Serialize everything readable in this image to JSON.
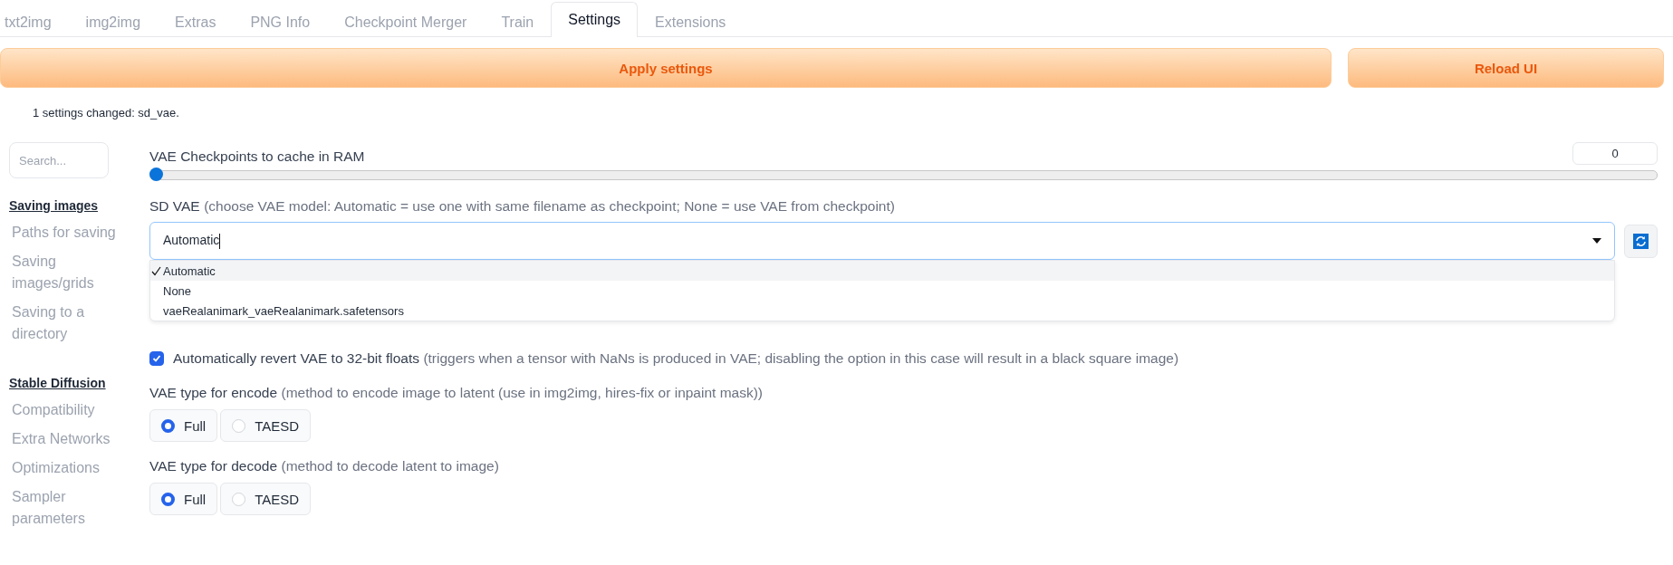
{
  "tabs": [
    {
      "label": "txt2img",
      "selected": false
    },
    {
      "label": "img2img",
      "selected": false
    },
    {
      "label": "Extras",
      "selected": false
    },
    {
      "label": "PNG Info",
      "selected": false
    },
    {
      "label": "Checkpoint Merger",
      "selected": false
    },
    {
      "label": "Train",
      "selected": false
    },
    {
      "label": "Settings",
      "selected": true
    },
    {
      "label": "Extensions",
      "selected": false
    }
  ],
  "buttons": [
    {
      "label": "Apply settings"
    },
    {
      "label": "Reload UI"
    }
  ],
  "status": "1 settings changed: sd_vae.",
  "sidebar": {
    "search": {
      "placeholder": "Search..."
    },
    "sections": [
      {
        "title": "Saving images",
        "items": [
          "Paths for saving",
          "Saving images/grids",
          "Saving to a directory"
        ]
      },
      {
        "title": "Stable Diffusion",
        "items": [
          "Compatibility",
          "Extra Networks",
          "Optimizations",
          "Sampler parameters"
        ]
      }
    ]
  },
  "settings": [
    {
      "kind": "slider",
      "label": "VAE Checkpoints to cache in RAM",
      "value": "0",
      "level": 0
    },
    {
      "kind": "dropdown",
      "label": "SD VAE",
      "hint": "(choose VAE model: Automatic = use one with same filename as checkpoint; None = use VAE from checkpoint)",
      "value": "Automatic",
      "expanded": true,
      "options": [
        {
          "label": "Automatic",
          "selected": true
        },
        {
          "label": "None",
          "selected": false
        },
        {
          "label": "vaeRealanimark_vaeRealanimark.safetensors",
          "selected": false
        }
      ]
    },
    {
      "kind": "checkbox",
      "label": "Automatically revert VAE to 32-bit floats",
      "hint": "(triggers when a tensor with NaNs is produced in VAE; disabling the option in this case will result in a black square image)",
      "checked": true
    },
    {
      "kind": "radio",
      "label": "VAE type for encode",
      "hint": "(method to encode image to latent (use in img2img, hires-fix or inpaint mask))",
      "options": [
        {
          "label": "Full",
          "selected": true
        },
        {
          "label": "TAESD",
          "selected": false
        }
      ]
    },
    {
      "kind": "radio",
      "label": "VAE type for decode",
      "hint": "(method to decode latent to image)",
      "options": [
        {
          "label": "Full",
          "selected": true
        },
        {
          "label": "TAESD",
          "selected": false
        }
      ]
    }
  ]
}
